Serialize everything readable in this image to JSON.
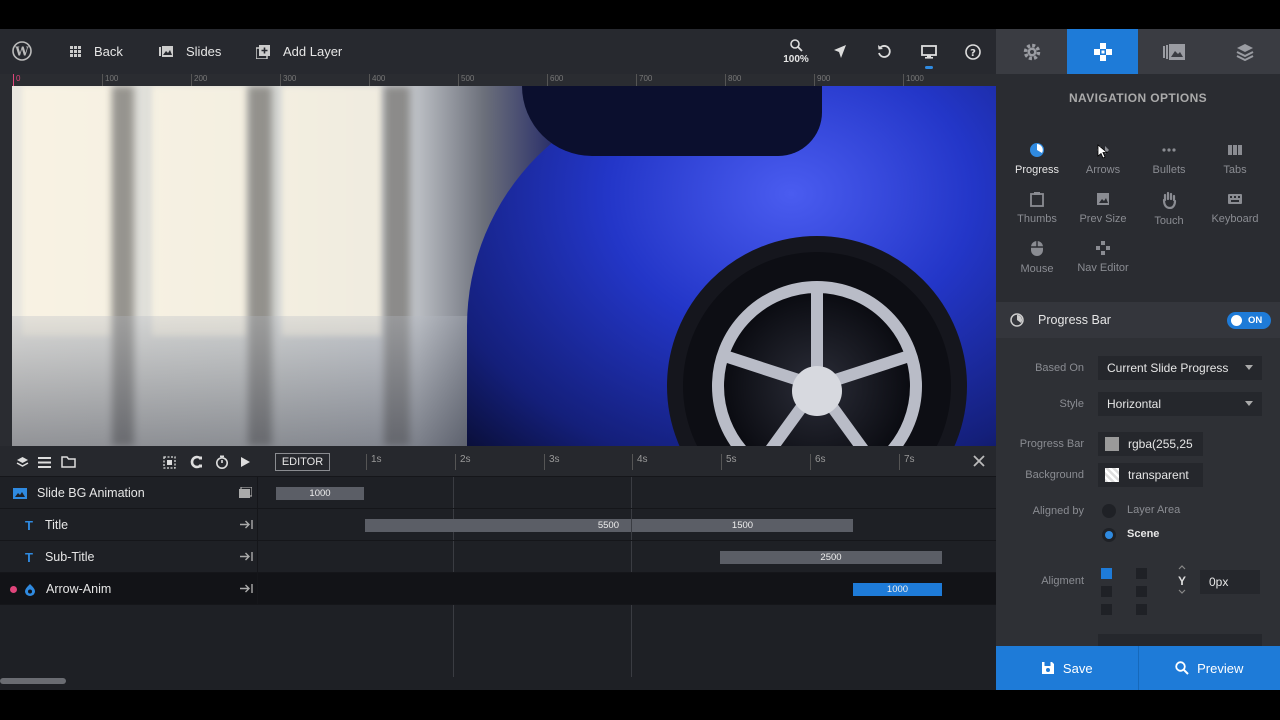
{
  "toolbar": {
    "back_label": "Back",
    "slides_label": "Slides",
    "add_layer_label": "Add Layer",
    "zoom_label": "100%"
  },
  "ruler": {
    "ticks": [
      "0",
      "100",
      "200",
      "300",
      "400",
      "500",
      "600",
      "700",
      "800",
      "900",
      "1000"
    ]
  },
  "timeline": {
    "editor_label": "EDITOR",
    "seconds": [
      "1s",
      "2s",
      "3s",
      "4s",
      "5s",
      "6s",
      "7s"
    ],
    "rows": [
      {
        "label": "Slide BG Animation",
        "bar_value": "1000"
      },
      {
        "label": "Title",
        "bar_value_1": "5500",
        "bar_value_2": "1500"
      },
      {
        "label": "Sub-Title",
        "bar_value": "2500"
      },
      {
        "label": "Arrow-Anim",
        "bar_value": "1000"
      }
    ]
  },
  "panel": {
    "title": "NAVIGATION OPTIONS",
    "nav_items": [
      "Progress",
      "Arrows",
      "Bullets",
      "Tabs",
      "Thumbs",
      "Prev Size",
      "Touch",
      "Keyboard",
      "Mouse",
      "Nav Editor"
    ],
    "section_title": "Progress Bar",
    "toggle_label": "ON",
    "based_on_label": "Based On",
    "based_on_value": "Current Slide Progress",
    "style_label": "Style",
    "style_value": "Horizontal",
    "progress_bar_label": "Progress Bar",
    "progress_bar_color": "rgba(255,25",
    "background_label": "Background",
    "background_value": "transparent",
    "aligned_by_label": "Aligned by",
    "aligned_options": [
      "Layer Area",
      "Scene"
    ],
    "alignment_label": "Aligment",
    "y_label": "Y",
    "y_value": "0px"
  },
  "savebar": {
    "save_label": "Save",
    "preview_label": "Preview"
  },
  "colors": {
    "accent": "#1e7bd8",
    "toolbar": "#27292f",
    "panel": "#2a2c31"
  },
  "icons": [
    "wordpress-icon",
    "grid-icon",
    "slides-icon",
    "add-layer-icon",
    "zoom-icon",
    "cursor-icon",
    "undo-icon",
    "desktop-icon",
    "help-icon",
    "gear-icon",
    "navigation-icon",
    "media-icon",
    "layers-icon"
  ]
}
